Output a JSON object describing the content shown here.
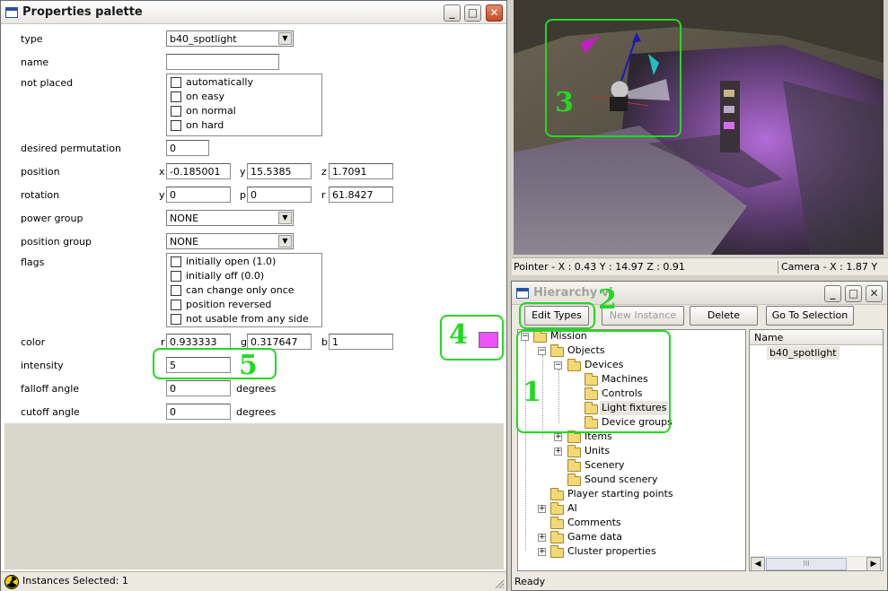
{
  "properties_window": {
    "title": "Properties palette",
    "rows": {
      "type": {
        "label": "type",
        "value": "b40_spotlight"
      },
      "name": {
        "label": "name",
        "value": ""
      },
      "not_placed": {
        "label": "not placed",
        "options": [
          "automatically",
          "on easy",
          "on normal",
          "on hard"
        ]
      },
      "desired_permutation": {
        "label": "desired permutation",
        "value": "0"
      },
      "position": {
        "label": "position",
        "x_label": "x",
        "x": "-0.185001",
        "y_label": "y",
        "y": "15.5385",
        "z_label": "z",
        "z": "1.7091"
      },
      "rotation": {
        "label": "rotation",
        "y_label": "y",
        "y": "0",
        "p_label": "p",
        "p": "0",
        "r_label": "r",
        "r": "61.8427"
      },
      "power_group": {
        "label": "power group",
        "value": "NONE"
      },
      "position_group": {
        "label": "position group",
        "value": "NONE"
      },
      "flags": {
        "label": "flags",
        "options": [
          "initially open (1.0)",
          "initially off (0.0)",
          "can change only once",
          "position reversed",
          "not usable from any side"
        ]
      },
      "color": {
        "label": "color",
        "r_label": "r",
        "r": "0.933333",
        "g_label": "g",
        "g": "0.317647",
        "b_label": "b",
        "b": "1",
        "swatch": "#ee51ff"
      },
      "intensity": {
        "label": "intensity",
        "value": "5"
      },
      "falloff_angle": {
        "label": "falloff angle",
        "value": "0",
        "unit": "degrees"
      },
      "cutoff_angle": {
        "label": "cutoff angle",
        "value": "0",
        "unit": "degrees"
      }
    },
    "status": "Instances Selected: 1"
  },
  "viewport": {
    "pointer_readout": "Pointer - X : 0.43  Y : 14.97  Z : 0.91",
    "camera_readout": "Camera - X : 1.87  Y"
  },
  "hierarchy_window": {
    "title": "Hierarchy vi",
    "buttons": {
      "edit_types": "Edit Types",
      "new_instance": "New Instance",
      "delete": "Delete",
      "go_to_selection": "Go To Selection"
    },
    "tree": {
      "mission": "Mission",
      "objects": "Objects",
      "devices": "Devices",
      "machines": "Machines",
      "controls": "Controls",
      "light_fixtures": "Light fixtures",
      "device_groups": "Device groups",
      "items": "Items",
      "units": "Units",
      "scenery": "Scenery",
      "sound_scenery": "Sound scenery",
      "player_starting_points": "Player starting points",
      "ai": "AI",
      "comments": "Comments",
      "game_data": "Game data",
      "cluster_properties": "Cluster properties"
    },
    "name_column": {
      "header": "Name",
      "items": [
        "b40_spotlight"
      ]
    },
    "scroll_grip": "III",
    "status": "Ready"
  },
  "annotations": {
    "n1": "1",
    "n2": "2",
    "n3": "3",
    "n4": "4",
    "n5": "5"
  },
  "colors": {
    "annotation_green": "#22d922",
    "accent_blue": "#2a4fa0"
  }
}
